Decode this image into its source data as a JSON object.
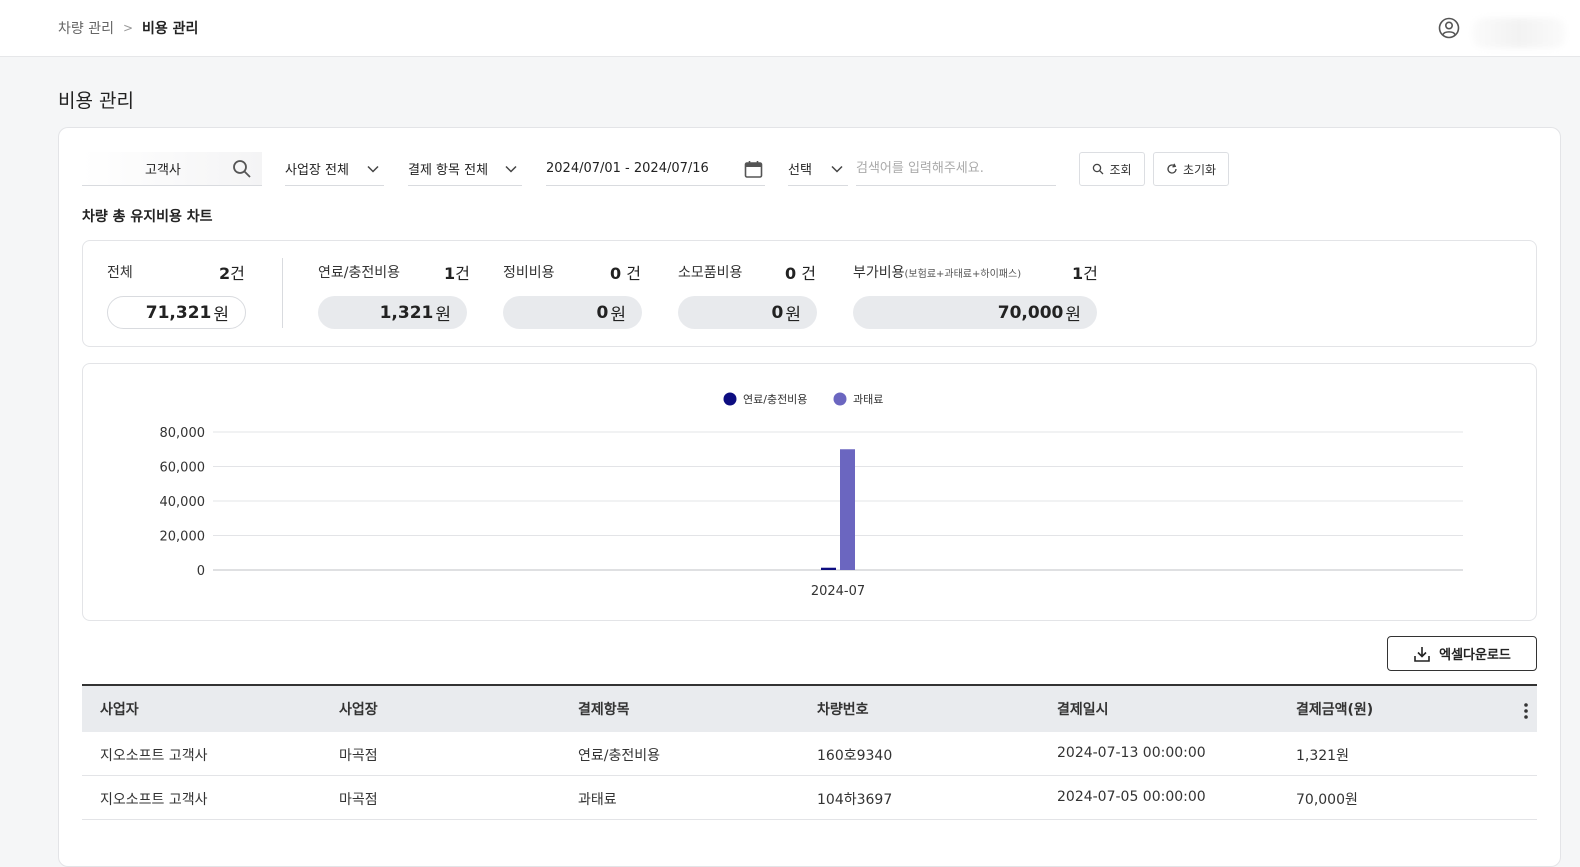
{
  "breadcrumb": {
    "parent": "차량 관리",
    "current": "비용 관리"
  },
  "page_title": "비용 관리",
  "filters": {
    "company": "고객사",
    "site": "사업장 전체",
    "payment_item": "결제 항목 전체",
    "date_range": "2024/07/01 - 2024/07/16",
    "select": "선택",
    "search_placeholder": "검색어를 입력해주세요.",
    "search_button": "조회",
    "reset_button": "초기화"
  },
  "section_title": "차량 총 유지비용 차트",
  "summary": {
    "total": {
      "label": "전체",
      "count": "2",
      "count_unit": "건",
      "amount": "71,321",
      "amount_unit": "원"
    },
    "fuel": {
      "label": "연료/충전비용",
      "count": "1",
      "count_unit": "건",
      "amount": "1,321",
      "amount_unit": "원"
    },
    "maintenance": {
      "label": "정비비용",
      "count": "0",
      "count_unit": " 건",
      "amount": "0",
      "amount_unit": " 원"
    },
    "consumables": {
      "label": "소모품비용",
      "count": "0",
      "count_unit": " 건",
      "amount": "0",
      "amount_unit": " 원"
    },
    "extra": {
      "label": "부가비용",
      "label_note": "(보험료+과태료+하이패스)",
      "count": "1",
      "count_unit": "건",
      "amount": "70,000",
      "amount_unit": " 원"
    }
  },
  "chart_data": {
    "type": "bar",
    "categories": [
      "2024-07"
    ],
    "series": [
      {
        "name": "연료/충전비용",
        "values": [
          1321
        ],
        "color": "#0d0d80"
      },
      {
        "name": "과태료",
        "values": [
          70000
        ],
        "color": "#6b66c0"
      }
    ],
    "y_ticks": [
      "80,000",
      "60,000",
      "40,000",
      "20,000",
      "0"
    ],
    "ylim": [
      0,
      80000
    ],
    "grid": true,
    "legend_position": "top-center"
  },
  "excel_button": "엑셀다운로드",
  "table": {
    "headers": [
      "사업자",
      "사업장",
      "결제항목",
      "차량번호",
      "결제일시",
      "결제금액(원)"
    ],
    "rows": [
      [
        "지오소프트 고객사",
        "마곡점",
        "연료/충전비용",
        "160호9340",
        "2024-07-13 00:00:00",
        "1,321원"
      ],
      [
        "지오소프트 고객사",
        "마곡점",
        "과태료",
        "104하3697",
        "2024-07-05 00:00:00",
        "70,000원"
      ]
    ]
  },
  "colors": {
    "accent": "#6b66c0",
    "navy": "#0d0d80",
    "pill_bg": "#e8eaed"
  }
}
